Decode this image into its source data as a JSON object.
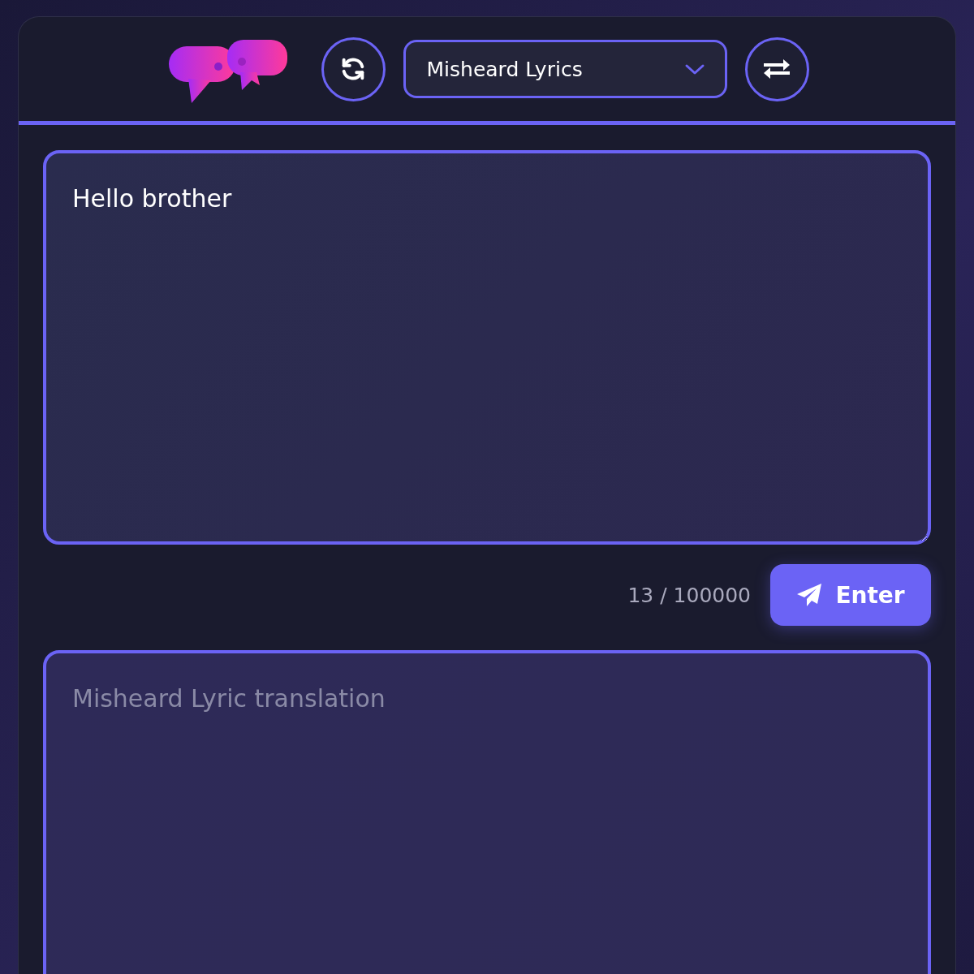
{
  "header": {
    "mode_select": {
      "value": "Misheard Lyrics"
    }
  },
  "input": {
    "value": "Hello brother",
    "char_count": "13 / 100000"
  },
  "enter_button": {
    "label": "Enter"
  },
  "output": {
    "placeholder": "Misheard Lyric translation"
  }
}
